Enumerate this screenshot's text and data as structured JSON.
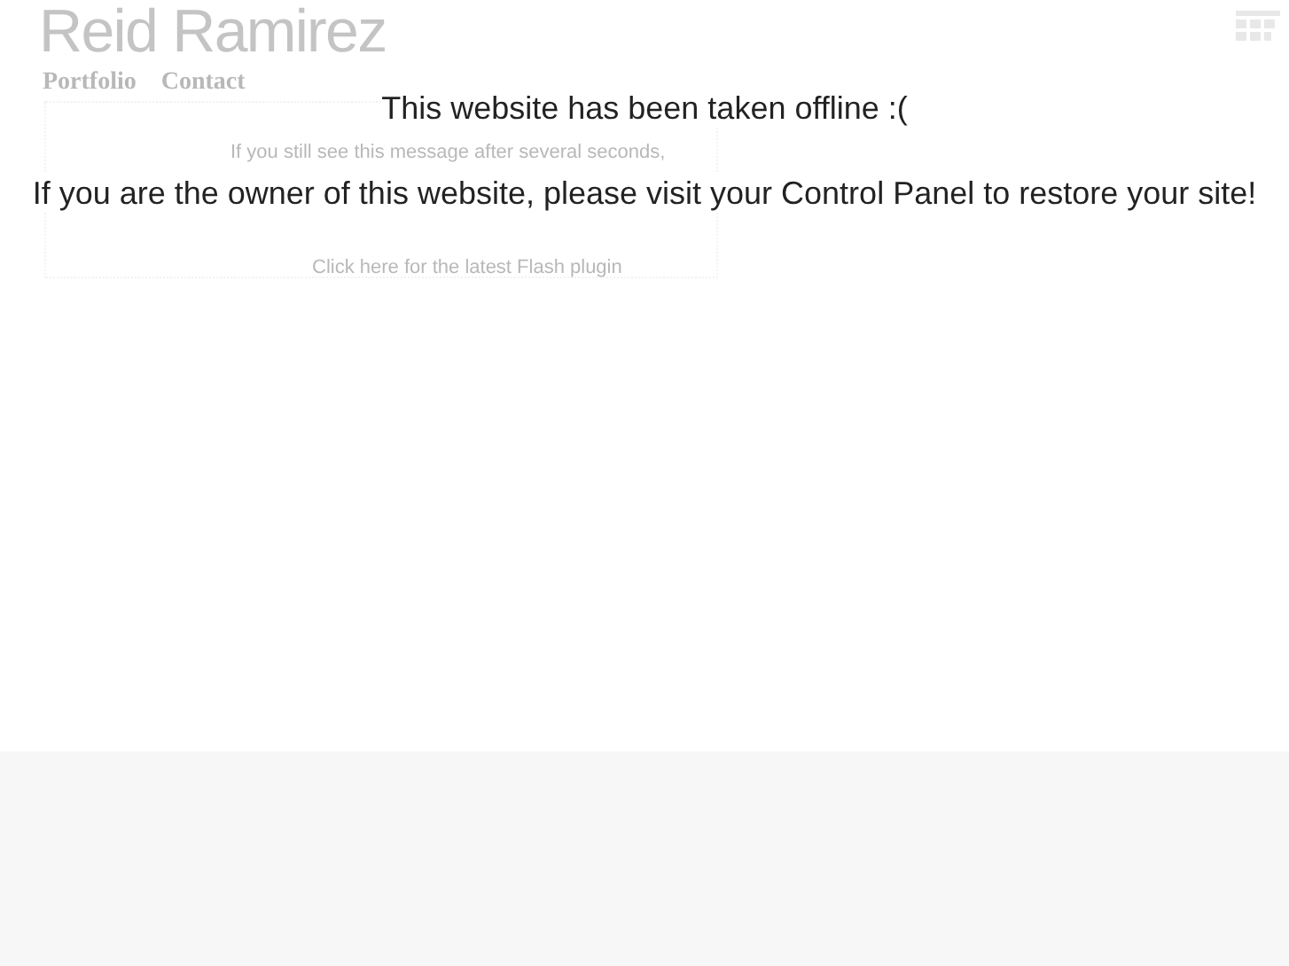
{
  "site": {
    "title": "Reid Ramirez",
    "nav": [
      {
        "label": "Portfolio"
      },
      {
        "label": "Contact"
      }
    ]
  },
  "loader": {
    "hint": "If you still see this message after several seconds,",
    "link": "Click here for the latest Flash plugin"
  },
  "notice": {
    "heading": "This website has been taken offline :(",
    "body": "If you are the owner of this website, please visit your Control Panel to restore your site!"
  }
}
